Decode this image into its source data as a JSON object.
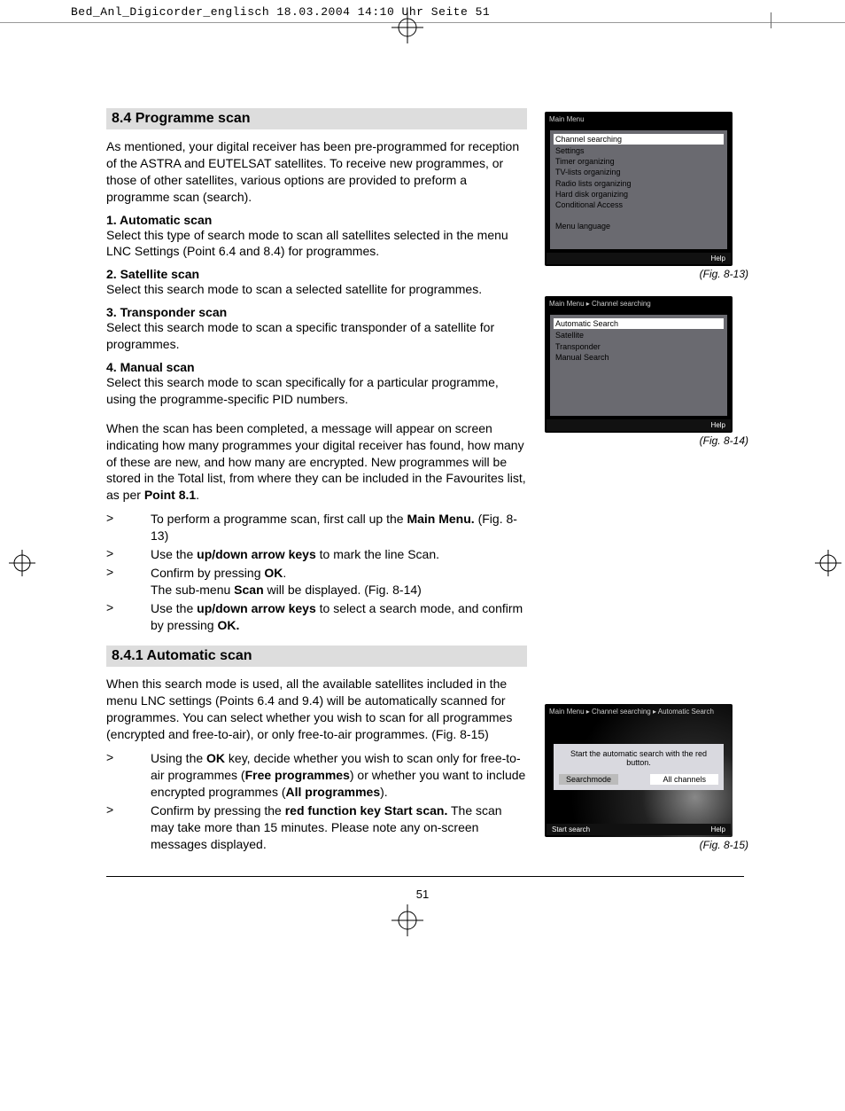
{
  "header_line": "Bed_Anl_Digicorder_englisch  18.03.2004  14:10 Uhr  Seite 51",
  "section1_title": "8.4 Programme scan",
  "intro": "As mentioned, your digital receiver has been pre-programmed for reception of the ASTRA and EUTELSAT satellites. To receive new programmes, or those of other satellites, various options are provided to preform a programme scan (search).",
  "s1_h": "1. Automatic scan",
  "s1_t": "Select this type of search mode to scan all satellites selected in the menu LNC Settings (Point 6.4  and 8.4) for programmes.",
  "s2_h": "2. Satellite scan",
  "s2_t": "Select this search mode to scan a selected satellite for programmes.",
  "s3_h": "3. Transponder scan",
  "s3_t": "Select this search mode to scan a specific transponder of a satellite for programmes.",
  "s4_h": "4. Manual scan",
  "s4_t": "Select this search mode to scan specifically for a particular programme, using the programme-specific PID numbers.",
  "after_scans_1": "When the scan has been completed, a message will appear on screen indicating how many programmes your digital receiver has found, how many of these are new, and how many are encrypted. New programmes will be stored in the Total list, from where they can be included in the Favourites list, as per ",
  "after_scans_bold": "Point 8.1",
  "bullets1": [
    {
      "pre": "To perform a programme scan, first call up the ",
      "b": "Main Menu.",
      "post": " (Fig. 8-13)"
    },
    {
      "pre": "Use the ",
      "b": "up/down arrow keys",
      "post": " to mark the line Scan."
    },
    {
      "pre": "Confirm by pressing ",
      "b": "OK",
      "post": ".",
      "extra_pre": "The sub-menu ",
      "extra_b": "Scan",
      "extra_post": " will be displayed. (Fig. 8-14)"
    },
    {
      "pre": "Use the ",
      "b": "up/down arrow keys",
      "post": " to select a search mode, and confirm by pressing ",
      "b2": "OK."
    }
  ],
  "section2_title": "8.4.1 Automatic scan",
  "sec2_intro": "When this search mode is used, all the available satellites included in the menu LNC settings (Points 6.4 and 9.4) will be automatically scanned for programmes. You can select whether you wish to scan for all programmes (encrypted and free-to-air), or only free-to-air programmes. (Fig. 8-15)",
  "bullets2": [
    {
      "pre": "Using the ",
      "b": "OK",
      "post": " key, decide whether you wish to scan only for free-to-air programmes (",
      "b2": "Free programmes",
      "post2": ") or whether you want to include encrypted programmes (",
      "b3": "All programmes",
      "post3": ")."
    },
    {
      "pre": "Confirm by pressing the ",
      "b": "red function key Start scan.",
      "post": " The scan may take more than 15 minutes. Please note any on-screen messages displayed."
    }
  ],
  "fig13": {
    "title": "Main Menu",
    "items": [
      "Channel searching",
      "Settings",
      "Timer organizing",
      "TV-lists organizing",
      "Radio lists organizing",
      "Hard disk organizing",
      "Conditional Access",
      "",
      "Menu language"
    ],
    "help": "Help",
    "caption": "(Fig. 8-13)"
  },
  "fig14": {
    "title": "Main Menu ▸ Channel searching",
    "items": [
      "Automatic Search",
      "Satellite",
      "Transponder",
      "Manual Search"
    ],
    "help": "Help",
    "caption": "(Fig. 8-14)"
  },
  "fig15": {
    "title": "Main Menu ▸ Channel searching ▸ Automatic Search",
    "dialog_text": "Start the automatic search with the red button.",
    "mode_label": "Searchmode",
    "mode_value": "All channels",
    "start": "Start search",
    "help": "Help",
    "caption": "(Fig. 8-15)"
  },
  "page_number": "51",
  "bullet_sym": ">"
}
